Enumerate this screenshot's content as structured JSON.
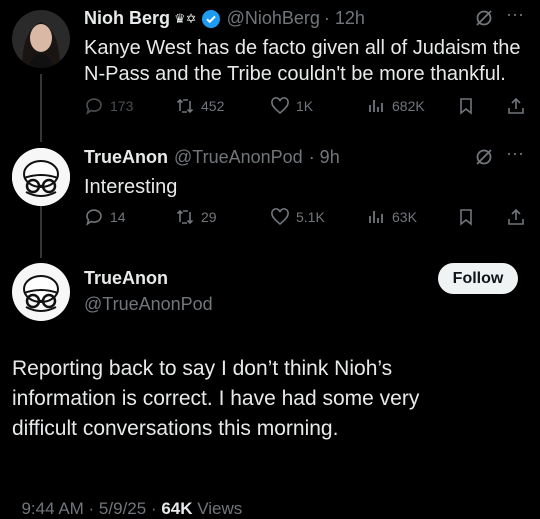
{
  "tweet1": {
    "name": "Nioh Berg",
    "badges": "♛✡",
    "handle": "@NiohBerg",
    "time": "· 12h",
    "text_line1": "Kanye West has de facto given all of Judaism the",
    "text_line2": "N-Pass and the Tribe couldn't be more thankful.",
    "replies": "173",
    "reposts": "452",
    "likes": "1K",
    "views": "682K",
    "verified_color": "#1d9bf0"
  },
  "tweet2": {
    "name": "TrueAnon",
    "handle": "@TrueAnonPod",
    "time": "· 9h",
    "text": "Interesting",
    "replies": "14",
    "reposts": "29",
    "likes": "5.1K",
    "views": "63K"
  },
  "main_tweet": {
    "name": "TrueAnon",
    "handle": "@TrueAnonPod",
    "follow_label": "Follow",
    "text_line1": "Reporting back to say I don’t think Nioh’s",
    "text_line2": "information is correct. I have had some very",
    "text_line3": "difficult conversations this morning.",
    "timestamp": "9:44 AM · 5/9/25 · ",
    "views_count": "64K",
    "views_label": " Views"
  }
}
